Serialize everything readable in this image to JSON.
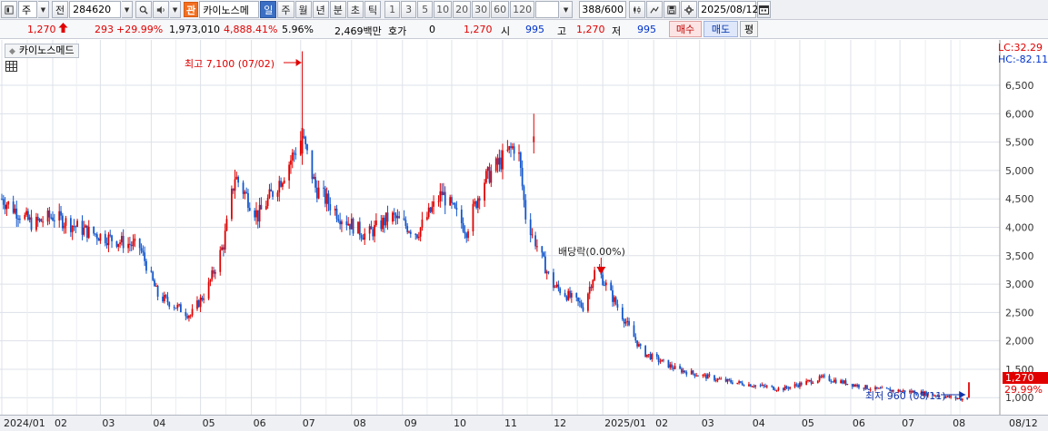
{
  "toolbar": {
    "period_select": "주",
    "compare_label": "전",
    "stock_code": "284620",
    "kwan_badge": "관",
    "stock_name_short": "카이노스메",
    "periods": [
      "일",
      "주",
      "월",
      "년",
      "분",
      "초",
      "틱"
    ],
    "active_period": "일",
    "intervals": [
      "1",
      "3",
      "5",
      "10",
      "20",
      "30",
      "60",
      "120"
    ],
    "count_display": "388/600",
    "date": "2025/08/12"
  },
  "quote": {
    "price": "1,270",
    "change": "293",
    "change_pct": "+29.99%",
    "volume": "1,973,010",
    "volume_pct": "4,888.41%",
    "turnover": "5.96%",
    "amount": "2,469백만",
    "hoga_label": "호가",
    "hoga_value": "0",
    "hoga_price": "1,270",
    "open_label": "시",
    "open_value": "995",
    "high_label": "고",
    "high_value": "1,270",
    "low_label": "저",
    "low_value": "995",
    "buy_label": "매수",
    "sell_label": "매도",
    "eval_label": "평"
  },
  "legend": {
    "series_name": "카이노스메드"
  },
  "indicators": {
    "lc": "LC:32.29",
    "hc": "HC:-82.11"
  },
  "annotations": {
    "high_label": "최고 7,100 (07/02)",
    "low_label": "최저 960 (08/11)",
    "dividend_label": "배당락(0.00%)",
    "last_price": "1,270",
    "last_change": "29.99%"
  },
  "colors": {
    "up": "#e00000",
    "down": "#1155cc",
    "kwan": "#f37021",
    "grid": "#dde1e8"
  },
  "chart_data": {
    "type": "candlestick",
    "yaxis_ticks": [
      "1,000",
      "1,500",
      "2,000",
      "2,500",
      "3,000",
      "3,500",
      "4,000",
      "4,500",
      "5,000",
      "5,500",
      "6,000",
      "6,500"
    ],
    "xaxis_labels": [
      "2024/01",
      "02",
      "03",
      "04",
      "05",
      "06",
      "07",
      "08",
      "09",
      "10",
      "11",
      "12",
      "2025/01",
      "02",
      "03",
      "04",
      "05",
      "06",
      "07",
      "08",
      "08/12"
    ],
    "ylim": [
      700,
      7300
    ],
    "close_path": [
      [
        "2024-01",
        4500
      ],
      [
        "2024-01-20",
        4050
      ],
      [
        "2024-02",
        4200
      ],
      [
        "2024-02-20",
        3950
      ],
      [
        "2024-03",
        3850
      ],
      [
        "2024-03-25",
        3650
      ],
      [
        "2024-04-05",
        2800
      ],
      [
        "2024-04-25",
        2450
      ],
      [
        "2024-05-05",
        2900
      ],
      [
        "2024-05-15",
        3700
      ],
      [
        "2024-05-22",
        4900
      ],
      [
        "2024-06-05",
        4200
      ],
      [
        "2024-06-20",
        4900
      ],
      [
        "2024-07-02",
        5600
      ],
      [
        "2024-07-10",
        4700
      ],
      [
        "2024-07-25",
        4200
      ],
      [
        "2024-08-10",
        3850
      ],
      [
        "2024-08-25",
        4200
      ],
      [
        "2024-09-10",
        3900
      ],
      [
        "2024-09-25",
        4600
      ],
      [
        "2024-10-10",
        3950
      ],
      [
        "2024-10-20",
        4800
      ],
      [
        "2024-11-01",
        5200
      ],
      [
        "2024-11-10",
        5500
      ],
      [
        "2024-11-15",
        4200
      ],
      [
        "2024-12-01",
        3000
      ],
      [
        "2024-12-20",
        2600
      ],
      [
        "2024-12-28",
        3300
      ],
      [
        "2025-01-10",
        2600
      ],
      [
        "2025-01-25",
        1800
      ],
      [
        "2025-02-15",
        1500
      ],
      [
        "2025-03-15",
        1300
      ],
      [
        "2025-04-20",
        1150
      ],
      [
        "2025-05-15",
        1350
      ],
      [
        "2025-06-15",
        1150
      ],
      [
        "2025-07-10",
        1100
      ],
      [
        "2025-08-11",
        960
      ],
      [
        "2025-08-12",
        1270
      ]
    ],
    "high": {
      "value": 7100,
      "date": "07/02"
    },
    "low": {
      "value": 960,
      "date": "08/11"
    },
    "last": {
      "close": 1270,
      "change_pct": 29.99
    }
  }
}
